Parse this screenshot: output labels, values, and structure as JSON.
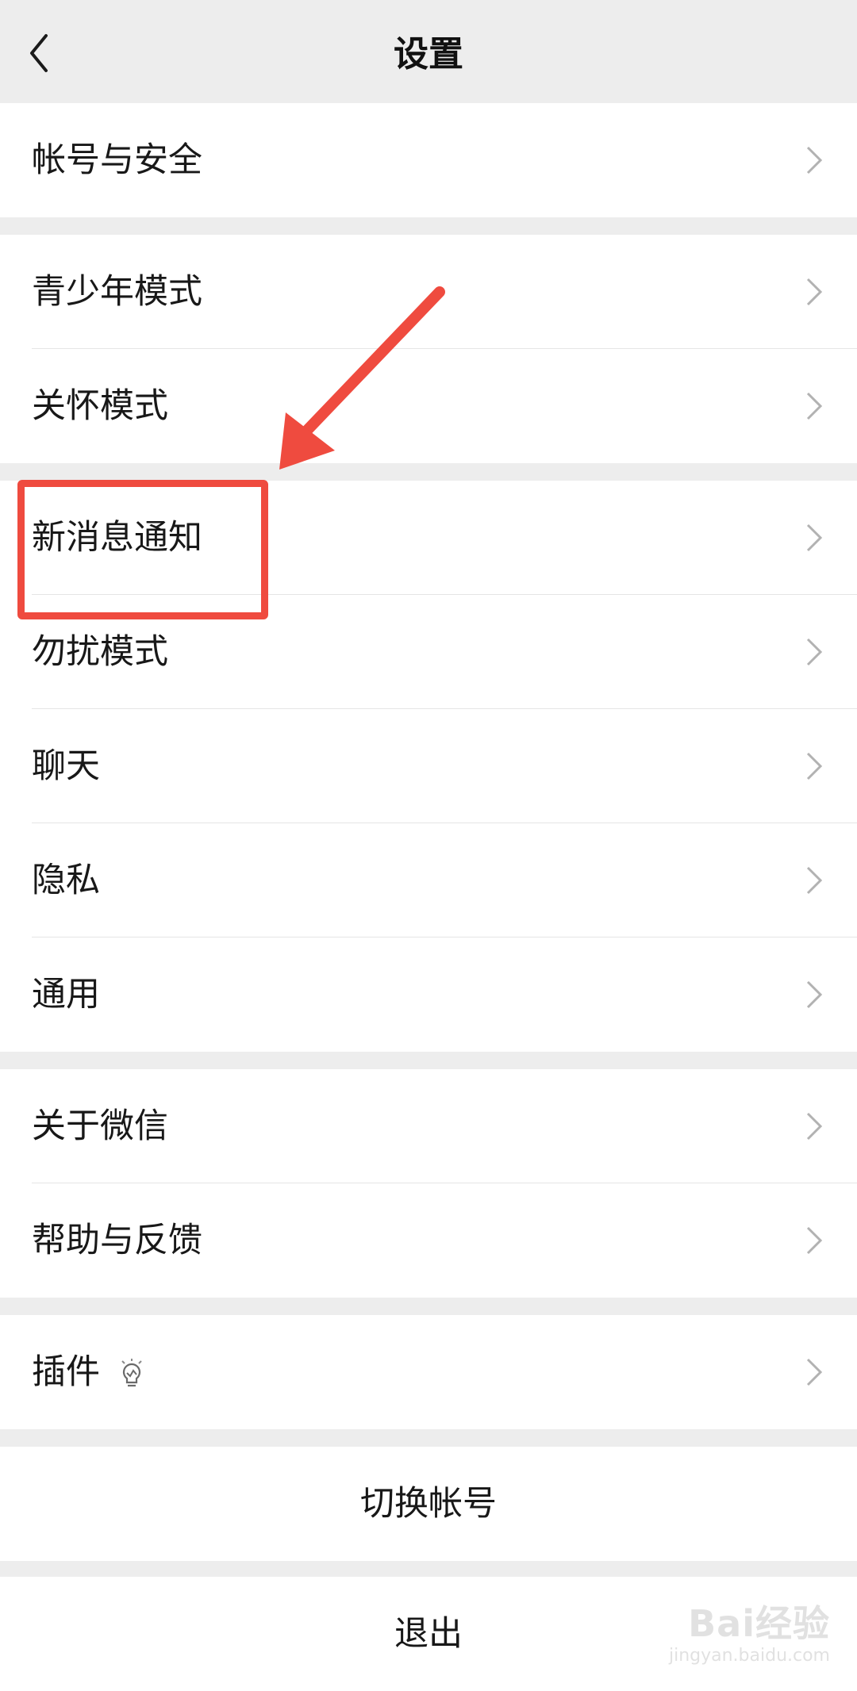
{
  "nav": {
    "title": "设置",
    "back_icon": "chevron-left-icon"
  },
  "groups": [
    {
      "items": [
        {
          "label": "帐号与安全"
        }
      ]
    },
    {
      "items": [
        {
          "label": "青少年模式"
        },
        {
          "label": "关怀模式"
        }
      ]
    },
    {
      "items": [
        {
          "label": "新消息通知"
        },
        {
          "label": "勿扰模式"
        },
        {
          "label": "聊天"
        },
        {
          "label": "隐私"
        },
        {
          "label": "通用"
        }
      ]
    },
    {
      "items": [
        {
          "label": "关于微信"
        },
        {
          "label": "帮助与反馈"
        }
      ]
    },
    {
      "items": [
        {
          "label": "插件",
          "icon": "lightbulb-icon"
        }
      ]
    }
  ],
  "actions": {
    "switch_account": "切换帐号",
    "logout": "退出"
  },
  "annotation": {
    "color": "#ef4b3f",
    "highlighted_item": "新消息通知"
  },
  "watermark": {
    "main": "Bai经验",
    "sub": "jingyan.baidu.com"
  },
  "colors": {
    "background": "#ededed",
    "cell": "#ffffff",
    "chevron": "#b2b2b2",
    "annotation": "#ef4b3f"
  }
}
